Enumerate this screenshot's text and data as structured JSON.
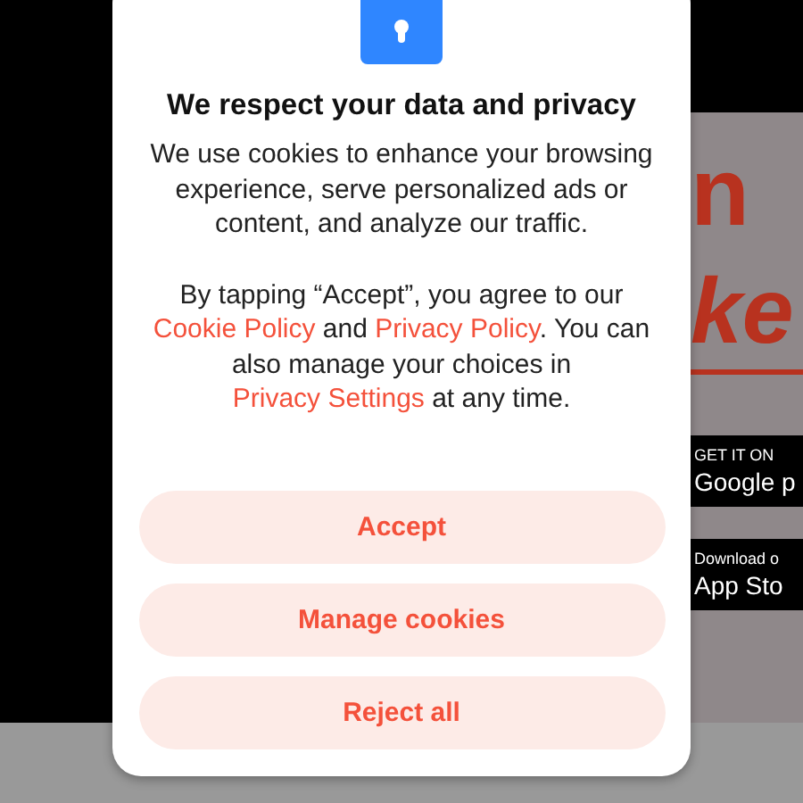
{
  "background_app": {
    "title_fragments": [
      "n",
      "ke"
    ],
    "badges": [
      {
        "caption": "GET IT ON",
        "store": "Google p"
      },
      {
        "caption": "Download o",
        "store": "App Sto"
      }
    ]
  },
  "dialog": {
    "title": "We respect your data and privacy",
    "paragraphs": [
      [
        {
          "kind": "text",
          "text": "We use cookies to enhance your browsing experience, serve personalized ads or content, and analyze our traffic."
        }
      ],
      [
        {
          "kind": "text",
          "text": "By tapping “Accept”, you agree to our "
        },
        {
          "kind": "link",
          "text": "Cookie Policy"
        },
        {
          "kind": "text",
          "text": " and "
        },
        {
          "kind": "link",
          "text": "Privacy Policy"
        },
        {
          "kind": "text",
          "text": ". You can also manage your choices in "
        },
        {
          "kind": "link",
          "text": "Privacy Settings"
        },
        {
          "kind": "text",
          "text": " at any time."
        }
      ]
    ],
    "buttons": [
      "Accept",
      "Manage cookies",
      "Reject all"
    ]
  }
}
